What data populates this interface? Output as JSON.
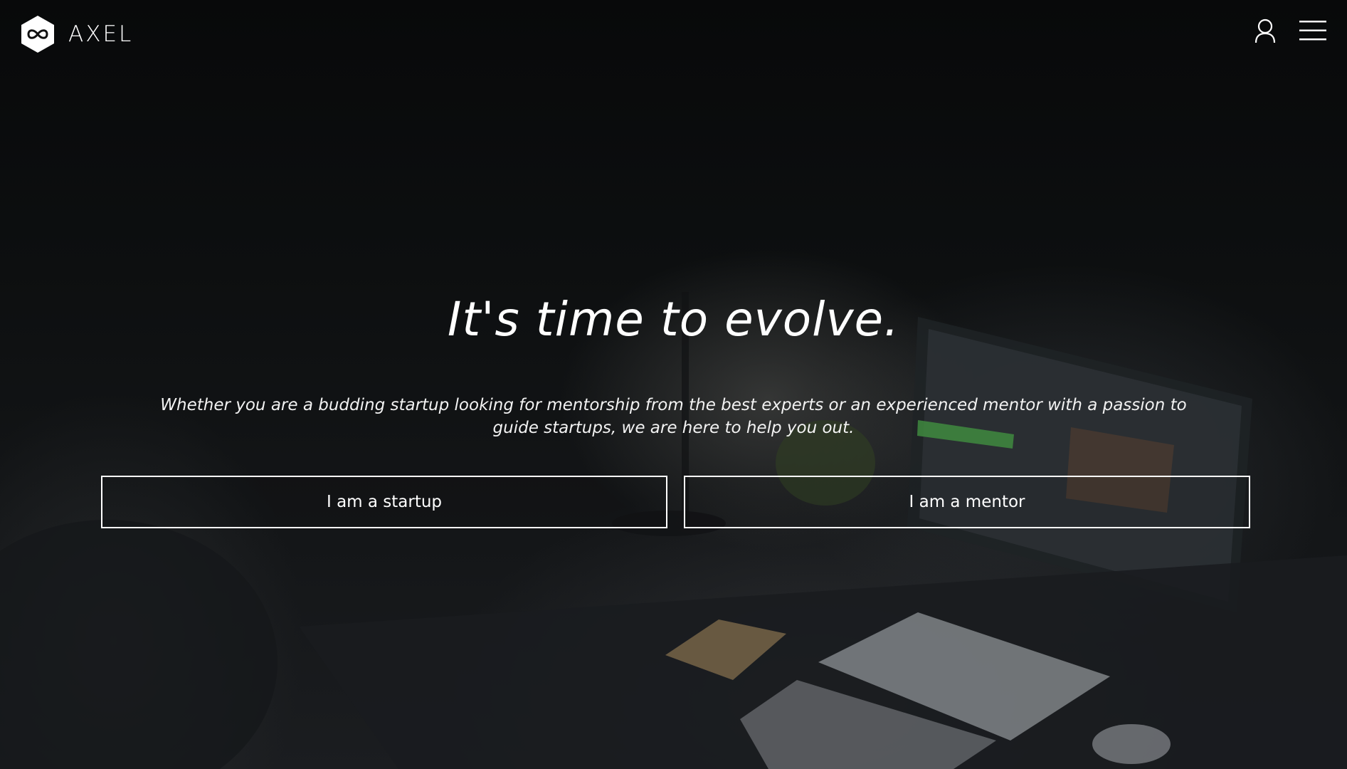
{
  "header": {
    "brand_name": "AXEL",
    "brand_icon": "infinity-hexagon-logo",
    "user_icon": "user-icon",
    "menu_icon": "hamburger-menu-icon"
  },
  "hero": {
    "headline": "It's time to evolve.",
    "subtext": "Whether you are a budding startup looking for mentorship from the best experts or an experienced mentor with a passion to guide startups, we are here to help you out.",
    "startup_button": "I am a startup",
    "mentor_button": "I am a mentor"
  },
  "colors": {
    "text": "#ffffff",
    "background": "#0a0b0c",
    "button_border": "#ffffff"
  }
}
